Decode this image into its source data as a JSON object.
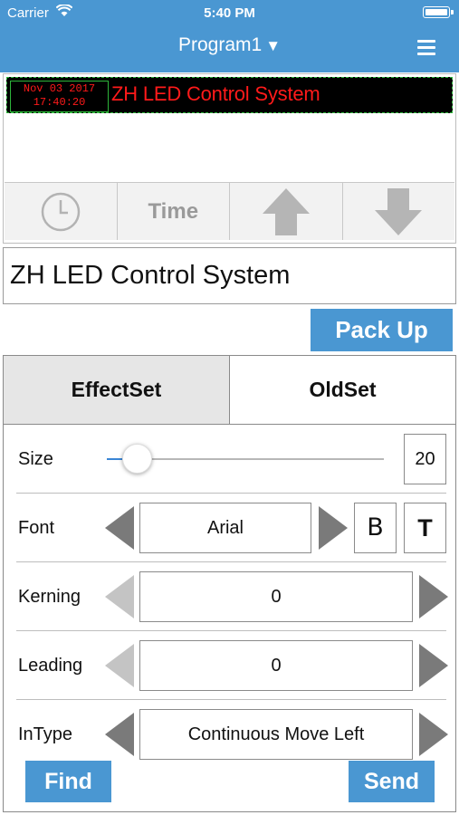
{
  "status_bar": {
    "carrier": "Carrier",
    "time": "5:40 PM"
  },
  "header": {
    "title": "Program1",
    "dropdown_caret": "▼",
    "menu_icon": "hamburger-menu-icon"
  },
  "preview": {
    "led_clock_line1": "Nov 03 2017",
    "led_clock_line2": "17:40:20",
    "led_text": "ZH LED Control System",
    "led_text_color": "#ff1a1a",
    "toolbar": {
      "clock_icon": "clock-icon",
      "time_label": "Time",
      "up_icon": "up-arrow-icon",
      "down_icon": "down-arrow-icon"
    }
  },
  "text_input": {
    "value": "ZH LED Control System"
  },
  "pack_up_label": "Pack Up",
  "tabs": [
    {
      "label": "EffectSet",
      "selected": true
    },
    {
      "label": "OldSet",
      "selected": false
    }
  ],
  "settings": {
    "size": {
      "label": "Size",
      "value": "20",
      "slider_fraction": 0.11
    },
    "font": {
      "label": "Font",
      "value": "Arial",
      "bold_label": "B",
      "text_label": "T"
    },
    "kerning": {
      "label": "Kerning",
      "value": "0"
    },
    "leading": {
      "label": "Leading",
      "value": "0"
    },
    "intype": {
      "label": "InType",
      "value": "Continuous Move Left"
    }
  },
  "actions": {
    "find_label": "Find",
    "send_label": "Send"
  },
  "colors": {
    "accent": "#4a97d2",
    "led_border": "#2db53a"
  }
}
